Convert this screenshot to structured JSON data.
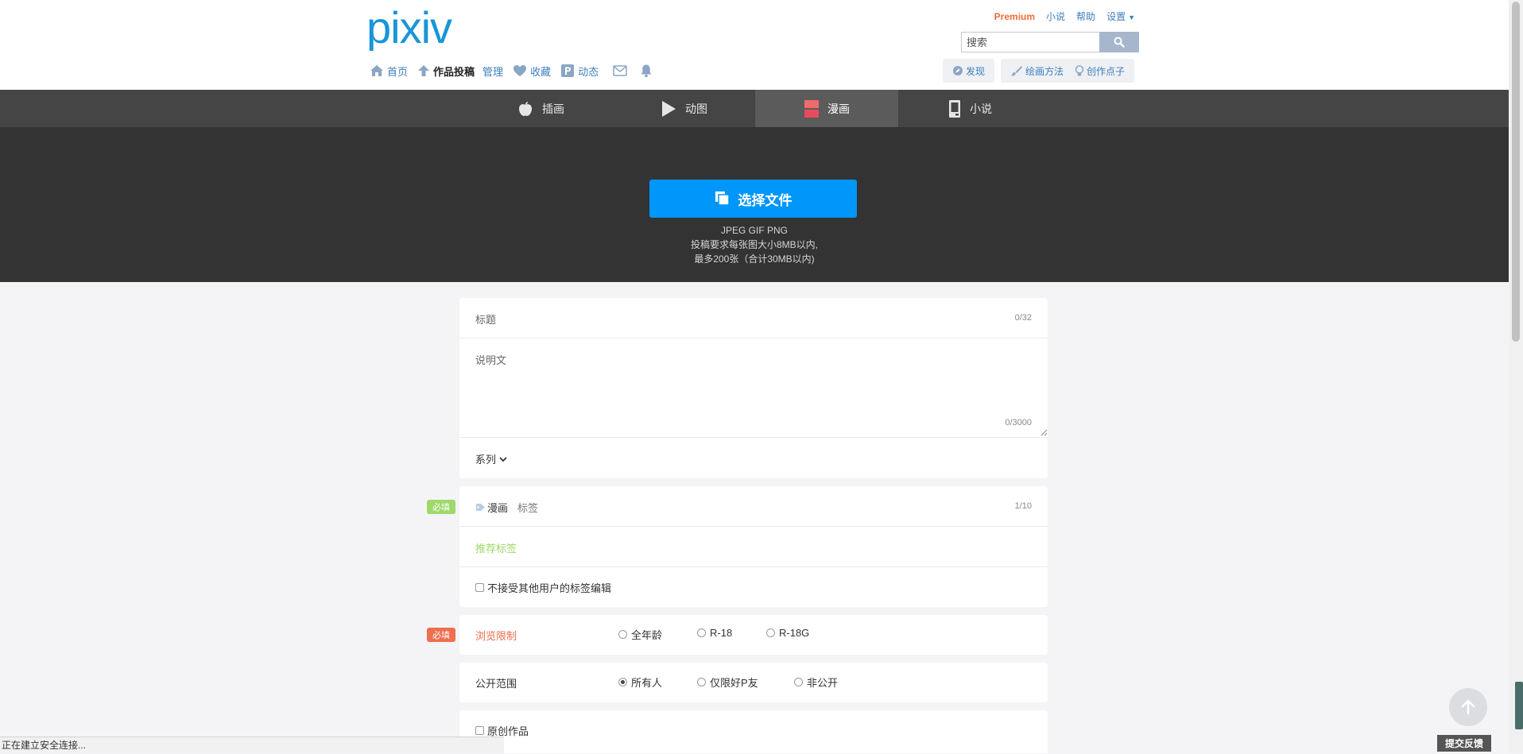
{
  "header": {
    "logo": "pixiv",
    "top_links": {
      "premium": "Premium",
      "novel": "小说",
      "help": "帮助",
      "settings": "设置"
    },
    "search": {
      "placeholder": "搜索",
      "value": ""
    },
    "nav": {
      "home": "首页",
      "post": "作品投稿",
      "manage": "管理",
      "bookmarks": "收藏",
      "feed": "动态"
    },
    "right_nav": {
      "discover": "发现",
      "howto": "绘画方法",
      "ideas": "创作点子"
    }
  },
  "tabs": [
    {
      "label": "插画",
      "icon": "apple-icon"
    },
    {
      "label": "动图",
      "icon": "play-icon"
    },
    {
      "label": "漫画",
      "icon": "manga-icon",
      "active": true
    },
    {
      "label": "小说",
      "icon": "book-icon"
    }
  ],
  "upload": {
    "button_label": "选择文件",
    "formats": "JPEG GIF PNG",
    "size_note": "投稿要求每张图大小8MB以内,",
    "count_note": "最多200张（合计30MB以内)"
  },
  "form": {
    "title": {
      "placeholder": "标题",
      "counter": "0/32"
    },
    "description": {
      "placeholder": "说明文",
      "counter": "0/3000"
    },
    "series": {
      "label": "系列"
    },
    "tags": {
      "badge": "必填",
      "fixed_tag": "漫画",
      "placeholder": "标签",
      "counter": "1/10",
      "recommended": "推荐标签",
      "lock_label": "不接受其他用户的标签编辑"
    },
    "age": {
      "badge": "必填",
      "label": "浏览限制",
      "options": [
        "全年龄",
        "R-18",
        "R-18G"
      ]
    },
    "visibility": {
      "label": "公开范围",
      "options": [
        "所有人",
        "仅限好P友",
        "非公开"
      ],
      "selected": "所有人"
    },
    "original": {
      "label": "原创作品"
    }
  },
  "status_bar": "正在建立安全连接...",
  "feedback": "提交反馈",
  "colors": {
    "accent": "#0096fa",
    "link": "#3d7ebf",
    "premium": "#f26b3a",
    "required_green": "#9fd86b",
    "required_red": "#ee6e4d",
    "dark_bg": "#333333",
    "tab_bg": "#454545"
  }
}
